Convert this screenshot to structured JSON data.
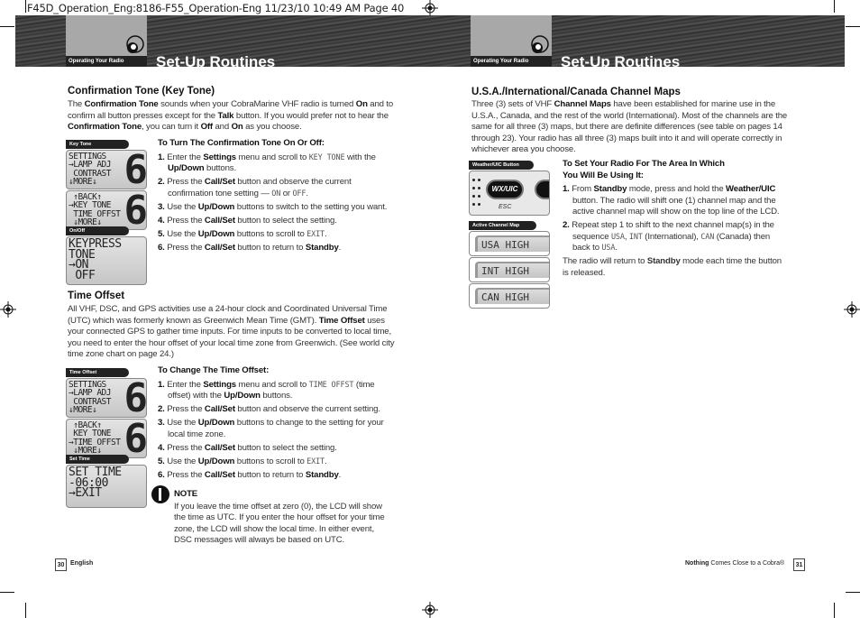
{
  "slug": "F45D_Operation_Eng:8186-F55_Operation-Eng  11/23/10  10:49 AM  Page 40",
  "left": {
    "section_tab": "Operating Your Radio",
    "title": "Set-Up Routines",
    "confirmation": {
      "heading": "Confirmation Tone (Key Tone)",
      "body": [
        {
          "t": "The "
        },
        {
          "b": "Confirmation Tone"
        },
        {
          "t": " sounds when your CobraMarine VHF radio is turned "
        },
        {
          "b": "On"
        },
        {
          "t": " and to confirm all button presses except for the "
        },
        {
          "b": "Talk"
        },
        {
          "t": " button. If you would prefer not to hear the "
        },
        {
          "b": "Confirmation Tone"
        },
        {
          "t": ", you can turn it "
        },
        {
          "b": "Off"
        },
        {
          "t": " and "
        },
        {
          "b": "On"
        },
        {
          "t": " as you choose."
        }
      ],
      "fig1_caption": "Key Tone",
      "fig1_screen1": [
        "SETTINGS",
        "→LAMP ADJ",
        " CONTRAST",
        "↓MORE↓"
      ],
      "fig1_screen2": [
        " ↑BACK↑",
        "→KEY TONE",
        " TIME OFFST",
        " ↓MORE↓"
      ],
      "fig2_caption": "On/Off",
      "fig2_screen": [
        "KEYPRESS",
        "TONE",
        "→ON",
        " OFF"
      ],
      "big_digit": "6",
      "steps_heading": "To Turn The Confirmation Tone On Or Off:",
      "steps": [
        [
          {
            "n": "1. "
          },
          {
            "t": "Enter the "
          },
          {
            "b": "Settings"
          },
          {
            "t": " menu and scroll to "
          },
          {
            "m": "KEY TONE"
          },
          {
            "t": " with the "
          },
          {
            "b": "Up/Down"
          },
          {
            "t": " buttons."
          }
        ],
        [
          {
            "n": "2. "
          },
          {
            "t": "Press the "
          },
          {
            "b": "Call/Set"
          },
          {
            "t": " button and observe the current confirmation tone setting — "
          },
          {
            "m": "ON"
          },
          {
            "t": " or "
          },
          {
            "m": "OFF"
          },
          {
            "t": "."
          }
        ],
        [
          {
            "n": "3. "
          },
          {
            "t": "Use the "
          },
          {
            "b": "Up/Down"
          },
          {
            "t": " buttons to switch to the setting you want."
          }
        ],
        [
          {
            "n": "4. "
          },
          {
            "t": "Press the "
          },
          {
            "b": "Call/Set"
          },
          {
            "t": " button to select the setting."
          }
        ],
        [
          {
            "n": "5. "
          },
          {
            "t": "Use the "
          },
          {
            "b": "Up/Down"
          },
          {
            "t": " buttons to scroll to "
          },
          {
            "m": "EXIT"
          },
          {
            "t": "."
          }
        ],
        [
          {
            "n": "6. "
          },
          {
            "t": "Press the "
          },
          {
            "b": "Call/Set"
          },
          {
            "t": " button to return to "
          },
          {
            "b": "Standby"
          },
          {
            "t": "."
          }
        ]
      ]
    },
    "time_offset": {
      "heading": "Time Offset",
      "body": [
        {
          "t": "All VHF, DSC, and GPS activities use a 24-hour clock and Coordinated Universal Time (UTC) which was formerly known as Greenwich Mean Time (GMT). "
        },
        {
          "b": "Time Offset"
        },
        {
          "t": " uses your connected GPS to gather time inputs. For time inputs to be converted to local time, you need to enter the hour offset of your local time zone from Greenwich. (See world city time zone chart on page 24.)"
        }
      ],
      "fig1_caption": "Time Offset",
      "fig1_screen1": [
        "SETTINGS",
        "→LAMP ADJ",
        " CONTRAST",
        "↓MORE↓"
      ],
      "fig1_screen2": [
        " ↑BACK↑",
        " KEY TONE",
        "→TIME OFFST",
        " ↓MORE↓"
      ],
      "fig2_caption": "Set Time",
      "fig2_screen": [
        "SET TIME",
        "-06:00",
        "→EXIT"
      ],
      "steps_heading": "To Change The Time Offset:",
      "steps": [
        [
          {
            "n": "1. "
          },
          {
            "t": "Enter the "
          },
          {
            "b": "Settings"
          },
          {
            "t": " menu and scroll to "
          },
          {
            "m": "TIME OFFST"
          },
          {
            "t": " (time offset) with the "
          },
          {
            "b": "Up/Down"
          },
          {
            "t": " buttons."
          }
        ],
        [
          {
            "n": "2. "
          },
          {
            "t": "Press the "
          },
          {
            "b": "Call/Set"
          },
          {
            "t": " button and observe the current setting."
          }
        ],
        [
          {
            "n": "3. "
          },
          {
            "t": "Use the "
          },
          {
            "b": "Up/Down"
          },
          {
            "t": " buttons to change to the setting for your local time zone."
          }
        ],
        [
          {
            "n": "4. "
          },
          {
            "t": "Press the "
          },
          {
            "b": "Call/Set"
          },
          {
            "t": " button to select the setting."
          }
        ],
        [
          {
            "n": "5. "
          },
          {
            "t": "Use the "
          },
          {
            "b": "Up/Down"
          },
          {
            "t": " buttons to scroll to "
          },
          {
            "m": "EXIT"
          },
          {
            "t": "."
          }
        ],
        [
          {
            "n": "6. "
          },
          {
            "t": "Press the "
          },
          {
            "b": "Call/Set"
          },
          {
            "t": " button to return to "
          },
          {
            "b": "Standby"
          },
          {
            "t": "."
          }
        ]
      ],
      "note_heading": "NOTE",
      "note_body": "If you leave the time offset at zero (0), the LCD will show the time as UTC. If you enter the hour offset for your time zone, the LCD will show the local time. In either event, DSC messages will always be based on UTC."
    },
    "page_number": "30",
    "footer": "English"
  },
  "right": {
    "section_tab": "Operating Your Radio",
    "title": "Set-Up Routines",
    "heading": "U.S.A./International/Canada Channel Maps",
    "body": [
      {
        "t": "Three (3) sets of VHF "
      },
      {
        "b": "Channel Maps"
      },
      {
        "t": " have been established for marine use in the U.S.A., Canada, and the rest of the world (International). Most of the channels are the same for all three (3) maps, but there are definite differences (see table on pages 14 through 23). Your radio has all three (3) maps built into it and will operate correctly in whichever area you choose."
      }
    ],
    "fig1_caption": "Weather/UIC Button",
    "wx_button": "WX/UIC",
    "esc_label": "ESC",
    "fig2_caption": "Active Channel Map",
    "channel_maps": [
      "USA HIGH",
      "INT HIGH",
      "CAN HIGH"
    ],
    "steps_heading": "To Set Your Radio For The Area In Which You Will Be Using It:",
    "steps": [
      [
        {
          "n": "1. "
        },
        {
          "t": "From "
        },
        {
          "b": "Standby"
        },
        {
          "t": " mode, press and hold the "
        },
        {
          "b": "Weather/UIC"
        },
        {
          "t": " button. The radio will shift one (1) channel map and the active channel map will show on the top line of the LCD."
        }
      ],
      [
        {
          "n": "2. "
        },
        {
          "t": "Repeat step 1 to shift to the next channel map(s) in the sequence "
        },
        {
          "m": "USA"
        },
        {
          "t": ", "
        },
        {
          "m": "INT"
        },
        {
          "t": " (International), "
        },
        {
          "m": "CAN"
        },
        {
          "t": " (Canada) then back to "
        },
        {
          "m": "USA"
        },
        {
          "t": "."
        }
      ]
    ],
    "closing": [
      {
        "t": "The radio will return to "
      },
      {
        "b": "Standby"
      },
      {
        "t": " mode each time the button is released."
      }
    ],
    "footer_bold": "Nothing",
    "footer_rest": " Comes Close to a Cobra®",
    "page_number": "31"
  }
}
